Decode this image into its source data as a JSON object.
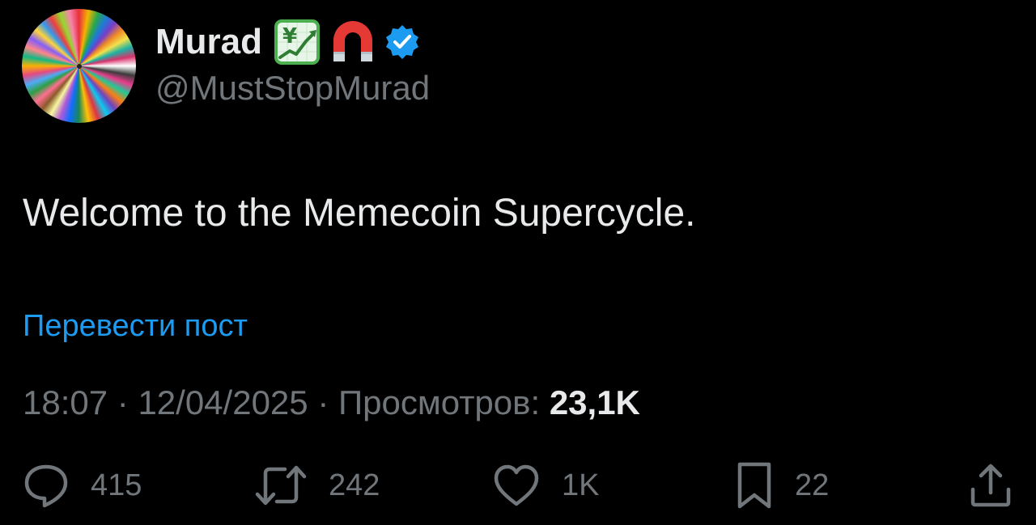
{
  "author": {
    "display_name": "Murad",
    "handle": "@MustStopMurad",
    "badges": [
      "chart-increasing-with-yen-emoji",
      "magnet-emoji",
      "verified-badge-icon"
    ],
    "verified_color": "#1d9bf0"
  },
  "post": {
    "text": "Welcome to the Memecoin Supercycle.",
    "translate_label": "Перевести пост"
  },
  "meta": {
    "time": "18:07",
    "separator": " · ",
    "date": "12/04/2025",
    "views_label": "Просмотров:",
    "views_count": "23,1K"
  },
  "actions": {
    "reply": {
      "icon": "reply-icon",
      "count": "415"
    },
    "retweet": {
      "icon": "retweet-icon",
      "count": "242"
    },
    "like": {
      "icon": "heart-icon",
      "count": "1K"
    },
    "bookmark": {
      "icon": "bookmark-icon",
      "count": "22"
    },
    "share": {
      "icon": "share-icon"
    }
  },
  "colors": {
    "background": "#000000",
    "primary_text": "#e7e9ea",
    "secondary_text": "#71767b",
    "link": "#1d9bf0"
  }
}
